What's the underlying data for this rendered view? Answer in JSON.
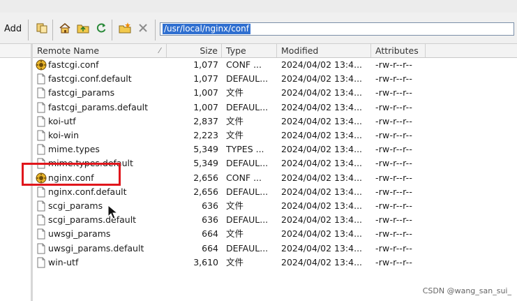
{
  "toolbar": {
    "add_label": "Add",
    "path": "/usr/local/nginx/conf"
  },
  "columns": {
    "name": "Remote Name",
    "size": "Size",
    "type": "Type",
    "modified": "Modified",
    "attributes": "Attributes"
  },
  "files": [
    {
      "name": "fastcgi.conf",
      "size": "1,077",
      "type": "CONF ...",
      "modified": "2024/04/02 13:4...",
      "attributes": "-rw-r--r--",
      "icon": "config-file-icon"
    },
    {
      "name": "fastcgi.conf.default",
      "size": "1,077",
      "type": "DEFAUL...",
      "modified": "2024/04/02 13:4...",
      "attributes": "-rw-r--r--",
      "icon": "file-icon"
    },
    {
      "name": "fastcgi_params",
      "size": "1,007",
      "type": "文件",
      "modified": "2024/04/02 13:4...",
      "attributes": "-rw-r--r--",
      "icon": "file-icon"
    },
    {
      "name": "fastcgi_params.default",
      "size": "1,007",
      "type": "DEFAUL...",
      "modified": "2024/04/02 13:4...",
      "attributes": "-rw-r--r--",
      "icon": "file-icon"
    },
    {
      "name": "koi-utf",
      "size": "2,837",
      "type": "文件",
      "modified": "2024/04/02 13:4...",
      "attributes": "-rw-r--r--",
      "icon": "file-icon"
    },
    {
      "name": "koi-win",
      "size": "2,223",
      "type": "文件",
      "modified": "2024/04/02 13:4...",
      "attributes": "-rw-r--r--",
      "icon": "file-icon"
    },
    {
      "name": "mime.types",
      "size": "5,349",
      "type": "TYPES ...",
      "modified": "2024/04/02 13:4...",
      "attributes": "-rw-r--r--",
      "icon": "file-icon"
    },
    {
      "name": "mime.types.default",
      "size": "5,349",
      "type": "DEFAUL...",
      "modified": "2024/04/02 13:4...",
      "attributes": "-rw-r--r--",
      "icon": "file-icon"
    },
    {
      "name": "nginx.conf",
      "size": "2,656",
      "type": "CONF ...",
      "modified": "2024/04/02 13:4...",
      "attributes": "-rw-r--r--",
      "icon": "config-file-icon"
    },
    {
      "name": "nginx.conf.default",
      "size": "2,656",
      "type": "DEFAUL...",
      "modified": "2024/04/02 13:4...",
      "attributes": "-rw-r--r--",
      "icon": "file-icon"
    },
    {
      "name": "scgi_params",
      "size": "636",
      "type": "文件",
      "modified": "2024/04/02 13:4...",
      "attributes": "-rw-r--r--",
      "icon": "file-icon"
    },
    {
      "name": "scgi_params.default",
      "size": "636",
      "type": "DEFAUL...",
      "modified": "2024/04/02 13:4...",
      "attributes": "-rw-r--r--",
      "icon": "file-icon"
    },
    {
      "name": "uwsgi_params",
      "size": "664",
      "type": "文件",
      "modified": "2024/04/02 13:4...",
      "attributes": "-rw-r--r--",
      "icon": "file-icon"
    },
    {
      "name": "uwsgi_params.default",
      "size": "664",
      "type": "DEFAUL...",
      "modified": "2024/04/02 13:4...",
      "attributes": "-rw-r--r--",
      "icon": "file-icon"
    },
    {
      "name": "win-utf",
      "size": "3,610",
      "type": "文件",
      "modified": "2024/04/02 13:4...",
      "attributes": "-rw-r--r--",
      "icon": "file-icon"
    }
  ],
  "highlighted_file": "nginx.conf",
  "colors": {
    "highlight": "#e0161c",
    "path_selection": "#2f6fd0"
  },
  "watermark": "CSDN @wang_san_sui_"
}
